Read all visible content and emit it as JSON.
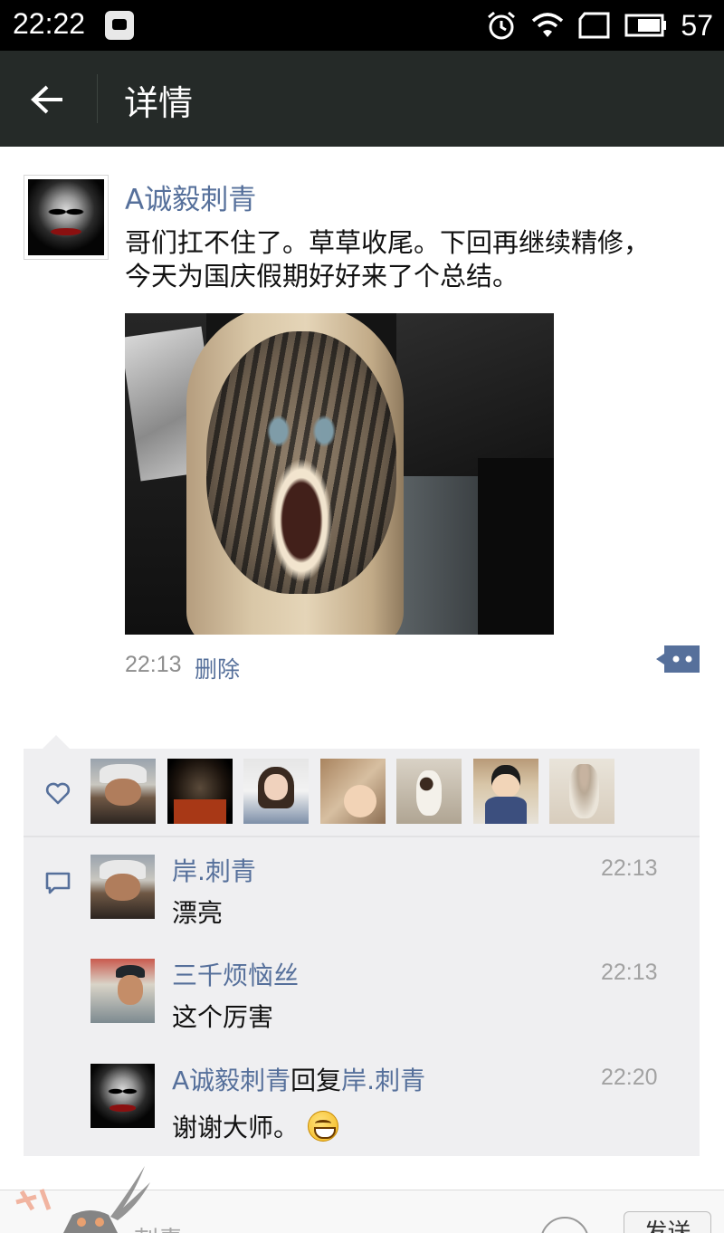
{
  "status_bar": {
    "time": "22:22",
    "battery": "57",
    "icons": [
      "app-notification-icon",
      "alarm-icon",
      "wifi-icon",
      "sim-icon",
      "battery-icon"
    ]
  },
  "app_bar": {
    "title": "详情",
    "back_icon": "arrow-left-icon"
  },
  "post": {
    "author": "A诚毅刺青",
    "text_line1": "哥们扛不住了。草草收尾。下回再继续精修，",
    "text_line2": "今天为国庆假期好好来了个总结。",
    "time": "22:13",
    "delete_label": "删除"
  },
  "likes": {
    "icon": "heart-icon",
    "count_shown": 7
  },
  "comments": [
    {
      "author": "岸.刺青",
      "time": "22:13",
      "text": "漂亮"
    },
    {
      "author": "三千烦恼丝",
      "time": "22:13",
      "text": "这个厉害"
    },
    {
      "author": "A诚毅刺青",
      "reply_word": "回复",
      "reply_to": "岸.刺青",
      "time": "22:20",
      "text": "谢谢大师。"
    }
  ],
  "input_bar": {
    "placeholder": "刺青",
    "send_label": "发送"
  },
  "colors": {
    "status_bar": "#000000",
    "app_bar": "#252a28",
    "link": "#56709b",
    "panel": "#efeff1"
  }
}
